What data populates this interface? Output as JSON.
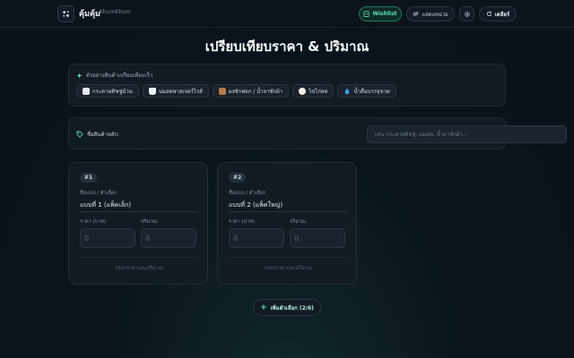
{
  "header": {
    "brand": "คุ้มคุ้ม",
    "brand_sub": "KhumKhum",
    "wishlist_label": "Wishlist",
    "unit_label": "แสดงหน่วย",
    "clear_label": "เคลียร์"
  },
  "title": "เปรียบเทียบราคา & ปริมาณ",
  "examples": {
    "heading": "ตัวอย่างสินค้าเปรียบเทียบเร็ว",
    "items": [
      {
        "label": "กระดาษทิชชู่ม้วน",
        "icon": "tissue-roll-icon"
      },
      {
        "label": "นมสดพาสเจอร์ไรส์",
        "icon": "milk-icon"
      },
      {
        "label": "ผงซักฟอก / น้ำยาซักผ้า",
        "icon": "detergent-icon"
      },
      {
        "label": "ไข่ไก่สด",
        "icon": "egg-icon"
      },
      {
        "label": "น้ำดื่มบรรจุขวด",
        "icon": "water-drop-icon"
      }
    ]
  },
  "product": {
    "label": "ชื่อสินค้าหลัก:",
    "placeholder": "เช่น กระดาษทิชชู่, นมสด, น้ำยาซักผ้า..."
  },
  "options": [
    {
      "badge": "#1",
      "name_label": "ชื่อแบบ / ตัวเลือก",
      "name_value": "แบบที่ 1 (แพ็คเล็ก)",
      "price_label": "ราคา (บาท)",
      "qty_label": "ปริมาณ",
      "price_placeholder": "0",
      "qty_placeholder": "0",
      "hint": "กรอกราคาและปริมาณ"
    },
    {
      "badge": "#2",
      "name_label": "ชื่อแบบ / ตัวเลือก",
      "name_value": "แบบที่ 2 (แพ็คใหญ่)",
      "price_label": "ราคา (บาท)",
      "qty_label": "ปริมาณ",
      "price_placeholder": "0",
      "qty_placeholder": "0",
      "hint": "กรอกราคาและปริมาณ"
    }
  ],
  "add_button_label": "เพิ่มตัวเลือก (2/6)",
  "colors": {
    "accent": "#5ee2b7",
    "background": "#0b141b",
    "panel": "#121a22"
  }
}
